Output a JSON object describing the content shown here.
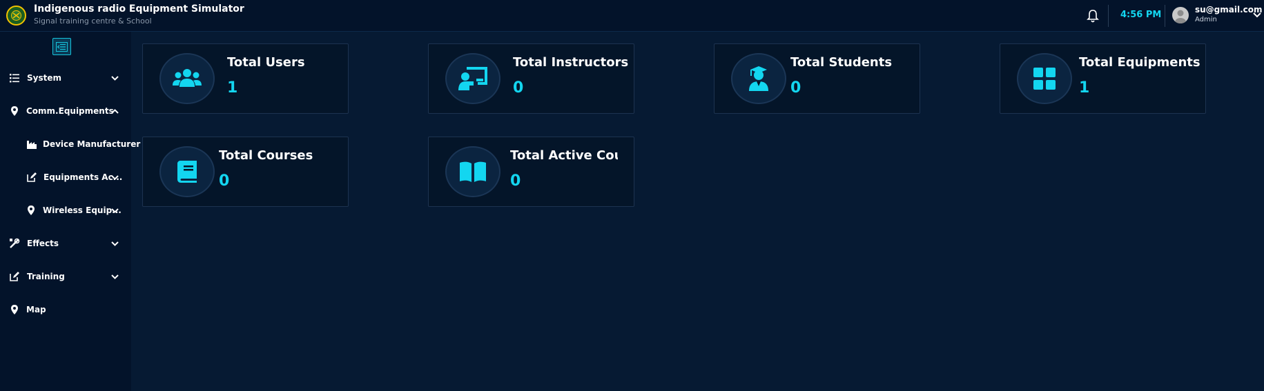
{
  "header": {
    "title": "Indigenous radio Equipment Simulator",
    "subtitle": "Signal training centre & School",
    "time": "4:56 PM",
    "user_email": "su@gmail.com",
    "user_role": "Admin",
    "icons": {
      "bell": "bell-icon",
      "avatar": "user-avatar-icon",
      "caret": "chevron-down-icon"
    }
  },
  "sidebar": {
    "items": [
      {
        "label": "System",
        "icon": "list-icon",
        "expanded": false
      },
      {
        "label": "Comm.Equipments",
        "icon": "location-pin-icon",
        "expanded": true
      },
      {
        "label": "Device Manufacturer",
        "icon": "factory-icon"
      },
      {
        "label": "Equipments Ac...",
        "icon": "edit-icon",
        "expanded": false
      },
      {
        "label": "Wireless Equip...",
        "icon": "location-pin-icon",
        "expanded": false
      },
      {
        "label": "Effects",
        "icon": "tools-icon",
        "expanded": false
      },
      {
        "label": "Training",
        "icon": "edit-icon",
        "expanded": false
      },
      {
        "label": "Map",
        "icon": "location-pin-icon"
      }
    ]
  },
  "cards": [
    {
      "title": "Total Users",
      "value": "1",
      "icon": "users-icon"
    },
    {
      "title": "Total Instructors",
      "value": "0",
      "icon": "instructor-board-icon"
    },
    {
      "title": "Total Students",
      "value": "0",
      "icon": "graduate-icon"
    },
    {
      "title": "Total Equipments",
      "value": "1",
      "icon": "grid-icon"
    },
    {
      "title": "Total Courses",
      "value": "0",
      "icon": "book-icon"
    },
    {
      "title": "Total Active Courses",
      "value": "0",
      "icon": "open-book-icon"
    }
  ],
  "colors": {
    "accent": "#13d6f0",
    "background": "#061a33",
    "panel": "#03132a"
  }
}
